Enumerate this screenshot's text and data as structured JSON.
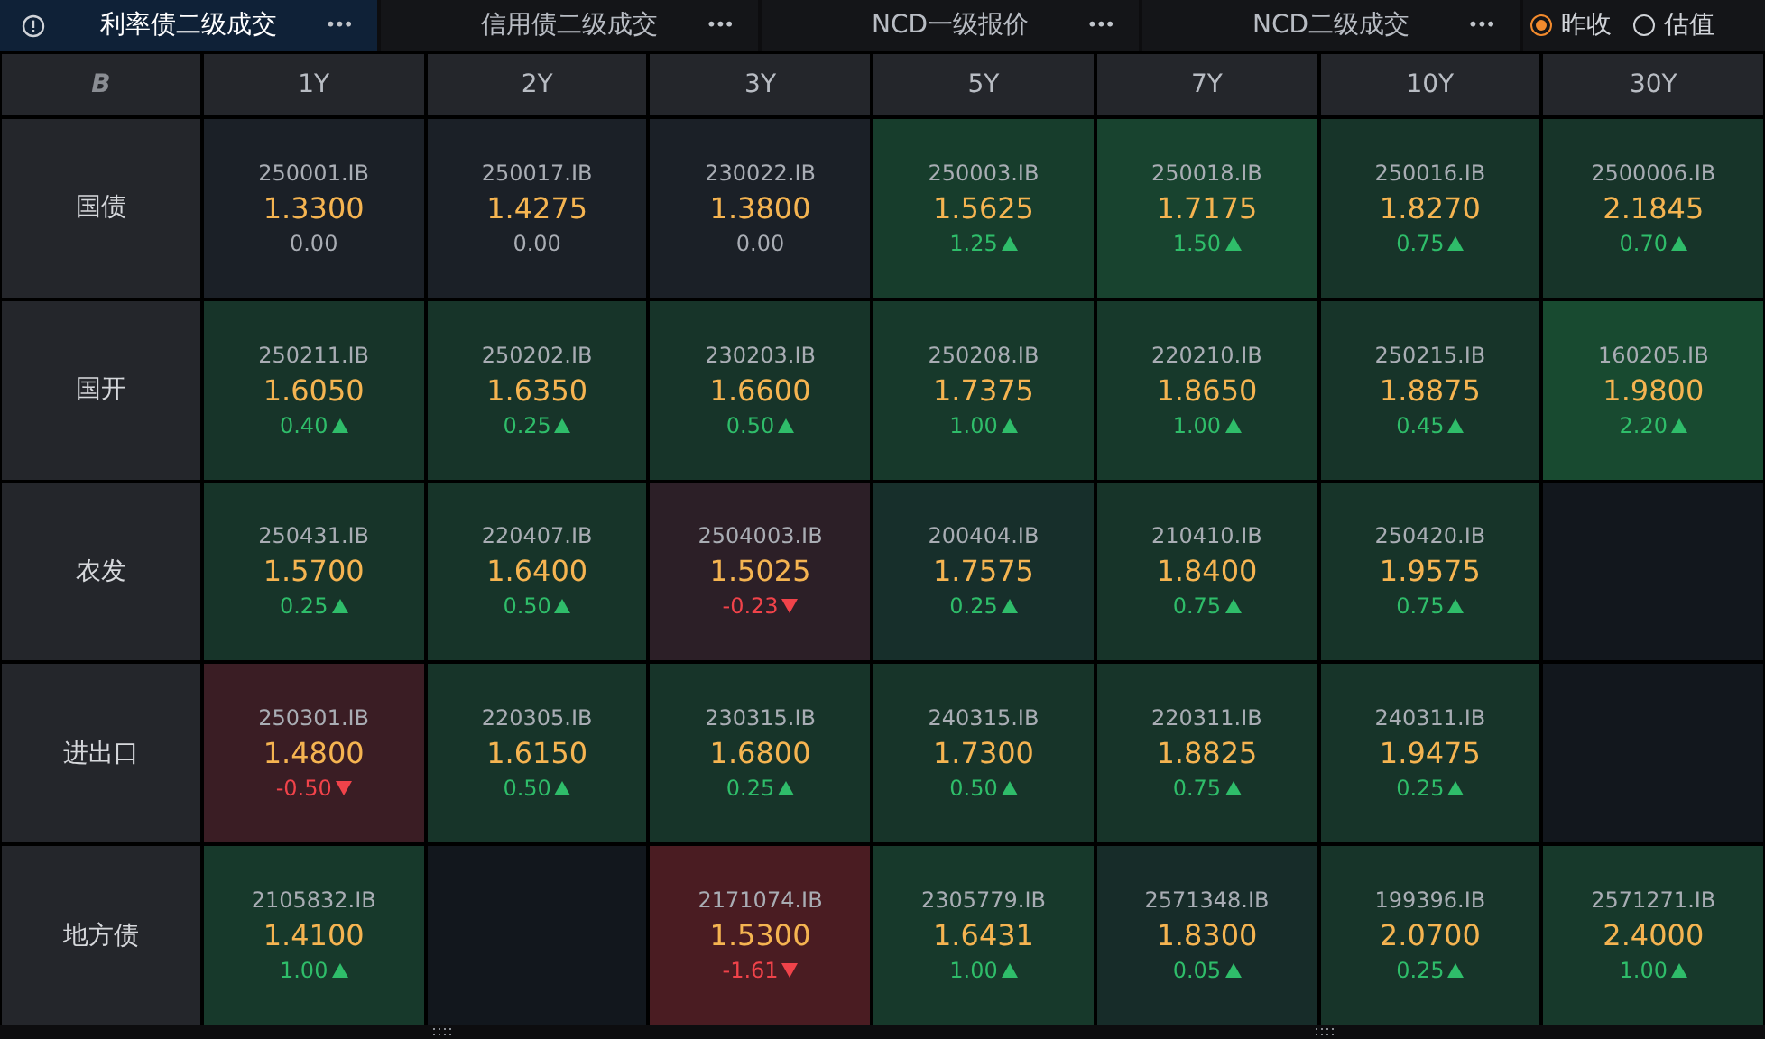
{
  "tabs": [
    {
      "label": "利率债二级成交",
      "selected": true,
      "info": true
    },
    {
      "label": "信用债二级成交",
      "selected": false,
      "info": false
    },
    {
      "label": "NCD一级报价",
      "selected": false,
      "info": false
    },
    {
      "label": "NCD二级成交",
      "selected": false,
      "info": false
    }
  ],
  "more_label": "•••",
  "radios": [
    {
      "label": "昨收",
      "selected": true
    },
    {
      "label": "估值",
      "selected": false
    }
  ],
  "corner": "B",
  "columns": [
    "1Y",
    "2Y",
    "3Y",
    "5Y",
    "7Y",
    "10Y",
    "30Y"
  ],
  "rows": [
    {
      "label": "国债",
      "cells": [
        {
          "code": "250001.IB",
          "price": "1.3300",
          "change": "0.00",
          "kind": "flat",
          "color": "#1b2027"
        },
        {
          "code": "250017.IB",
          "price": "1.4275",
          "change": "0.00",
          "kind": "flat",
          "color": "#1b2027"
        },
        {
          "code": "230022.IB",
          "price": "1.3800",
          "change": "0.00",
          "kind": "flat",
          "color": "#1b2027"
        },
        {
          "code": "250003.IB",
          "price": "1.5625",
          "change": "1.25",
          "kind": "up",
          "color": "#173d2c"
        },
        {
          "code": "250018.IB",
          "price": "1.7175",
          "change": "1.50",
          "kind": "up",
          "color": "#18432f"
        },
        {
          "code": "250016.IB",
          "price": "1.8270",
          "change": "0.75",
          "kind": "up",
          "color": "#173429"
        },
        {
          "code": "2500006.IB",
          "price": "2.1845",
          "change": "0.70",
          "kind": "up",
          "color": "#173429"
        }
      ]
    },
    {
      "label": "国开",
      "cells": [
        {
          "code": "250211.IB",
          "price": "1.6050",
          "change": "0.40",
          "kind": "up",
          "color": "#173429"
        },
        {
          "code": "250202.IB",
          "price": "1.6350",
          "change": "0.25",
          "kind": "up",
          "color": "#173429"
        },
        {
          "code": "230203.IB",
          "price": "1.6600",
          "change": "0.50",
          "kind": "up",
          "color": "#173429"
        },
        {
          "code": "250208.IB",
          "price": "1.7375",
          "change": "1.00",
          "kind": "up",
          "color": "#17392b"
        },
        {
          "code": "220210.IB",
          "price": "1.8650",
          "change": "1.00",
          "kind": "up",
          "color": "#17392b"
        },
        {
          "code": "250215.IB",
          "price": "1.8875",
          "change": "0.45",
          "kind": "up",
          "color": "#173429"
        },
        {
          "code": "160205.IB",
          "price": "1.9800",
          "change": "2.20",
          "kind": "up",
          "color": "#184a30"
        }
      ]
    },
    {
      "label": "农发",
      "cells": [
        {
          "code": "250431.IB",
          "price": "1.5700",
          "change": "0.25",
          "kind": "up",
          "color": "#173429"
        },
        {
          "code": "220407.IB",
          "price": "1.6400",
          "change": "0.50",
          "kind": "up",
          "color": "#173429"
        },
        {
          "code": "2504003.IB",
          "price": "1.5025",
          "change": "-0.23",
          "kind": "down",
          "color": "#2c1f27"
        },
        {
          "code": "200404.IB",
          "price": "1.7575",
          "change": "0.25",
          "kind": "up",
          "color": "#172f2b"
        },
        {
          "code": "210410.IB",
          "price": "1.8400",
          "change": "0.75",
          "kind": "up",
          "color": "#173429"
        },
        {
          "code": "250420.IB",
          "price": "1.9575",
          "change": "0.75",
          "kind": "up",
          "color": "#173429"
        },
        {
          "kind": "empty",
          "color": "#12171d"
        }
      ]
    },
    {
      "label": "进出口",
      "cells": [
        {
          "code": "250301.IB",
          "price": "1.4800",
          "change": "-0.50",
          "kind": "down",
          "color": "#3a1d24"
        },
        {
          "code": "220305.IB",
          "price": "1.6150",
          "change": "0.50",
          "kind": "up",
          "color": "#173429"
        },
        {
          "code": "230315.IB",
          "price": "1.6800",
          "change": "0.25",
          "kind": "up",
          "color": "#173429"
        },
        {
          "code": "240315.IB",
          "price": "1.7300",
          "change": "0.50",
          "kind": "up",
          "color": "#173429"
        },
        {
          "code": "220311.IB",
          "price": "1.8825",
          "change": "0.75",
          "kind": "up",
          "color": "#173429"
        },
        {
          "code": "240311.IB",
          "price": "1.9475",
          "change": "0.25",
          "kind": "up",
          "color": "#173429"
        },
        {
          "kind": "empty",
          "color": "#12171d"
        }
      ]
    },
    {
      "label": "地方债",
      "cells": [
        {
          "code": "2105832.IB",
          "price": "1.4100",
          "change": "1.00",
          "kind": "up",
          "color": "#17392b"
        },
        {
          "kind": "empty",
          "color": "#12171d"
        },
        {
          "code": "2171074.IB",
          "price": "1.5300",
          "change": "-1.61",
          "kind": "down",
          "color": "#4a1c22"
        },
        {
          "code": "2305779.IB",
          "price": "1.6431",
          "change": "1.00",
          "kind": "up",
          "color": "#17392b"
        },
        {
          "code": "2571348.IB",
          "price": "1.8300",
          "change": "0.05",
          "kind": "up",
          "color": "#172c29"
        },
        {
          "code": "199396.IB",
          "price": "2.0700",
          "change": "0.25",
          "kind": "up",
          "color": "#173429"
        },
        {
          "code": "2571271.IB",
          "price": "2.4000",
          "change": "1.00",
          "kind": "up",
          "color": "#17392b"
        }
      ]
    }
  ]
}
